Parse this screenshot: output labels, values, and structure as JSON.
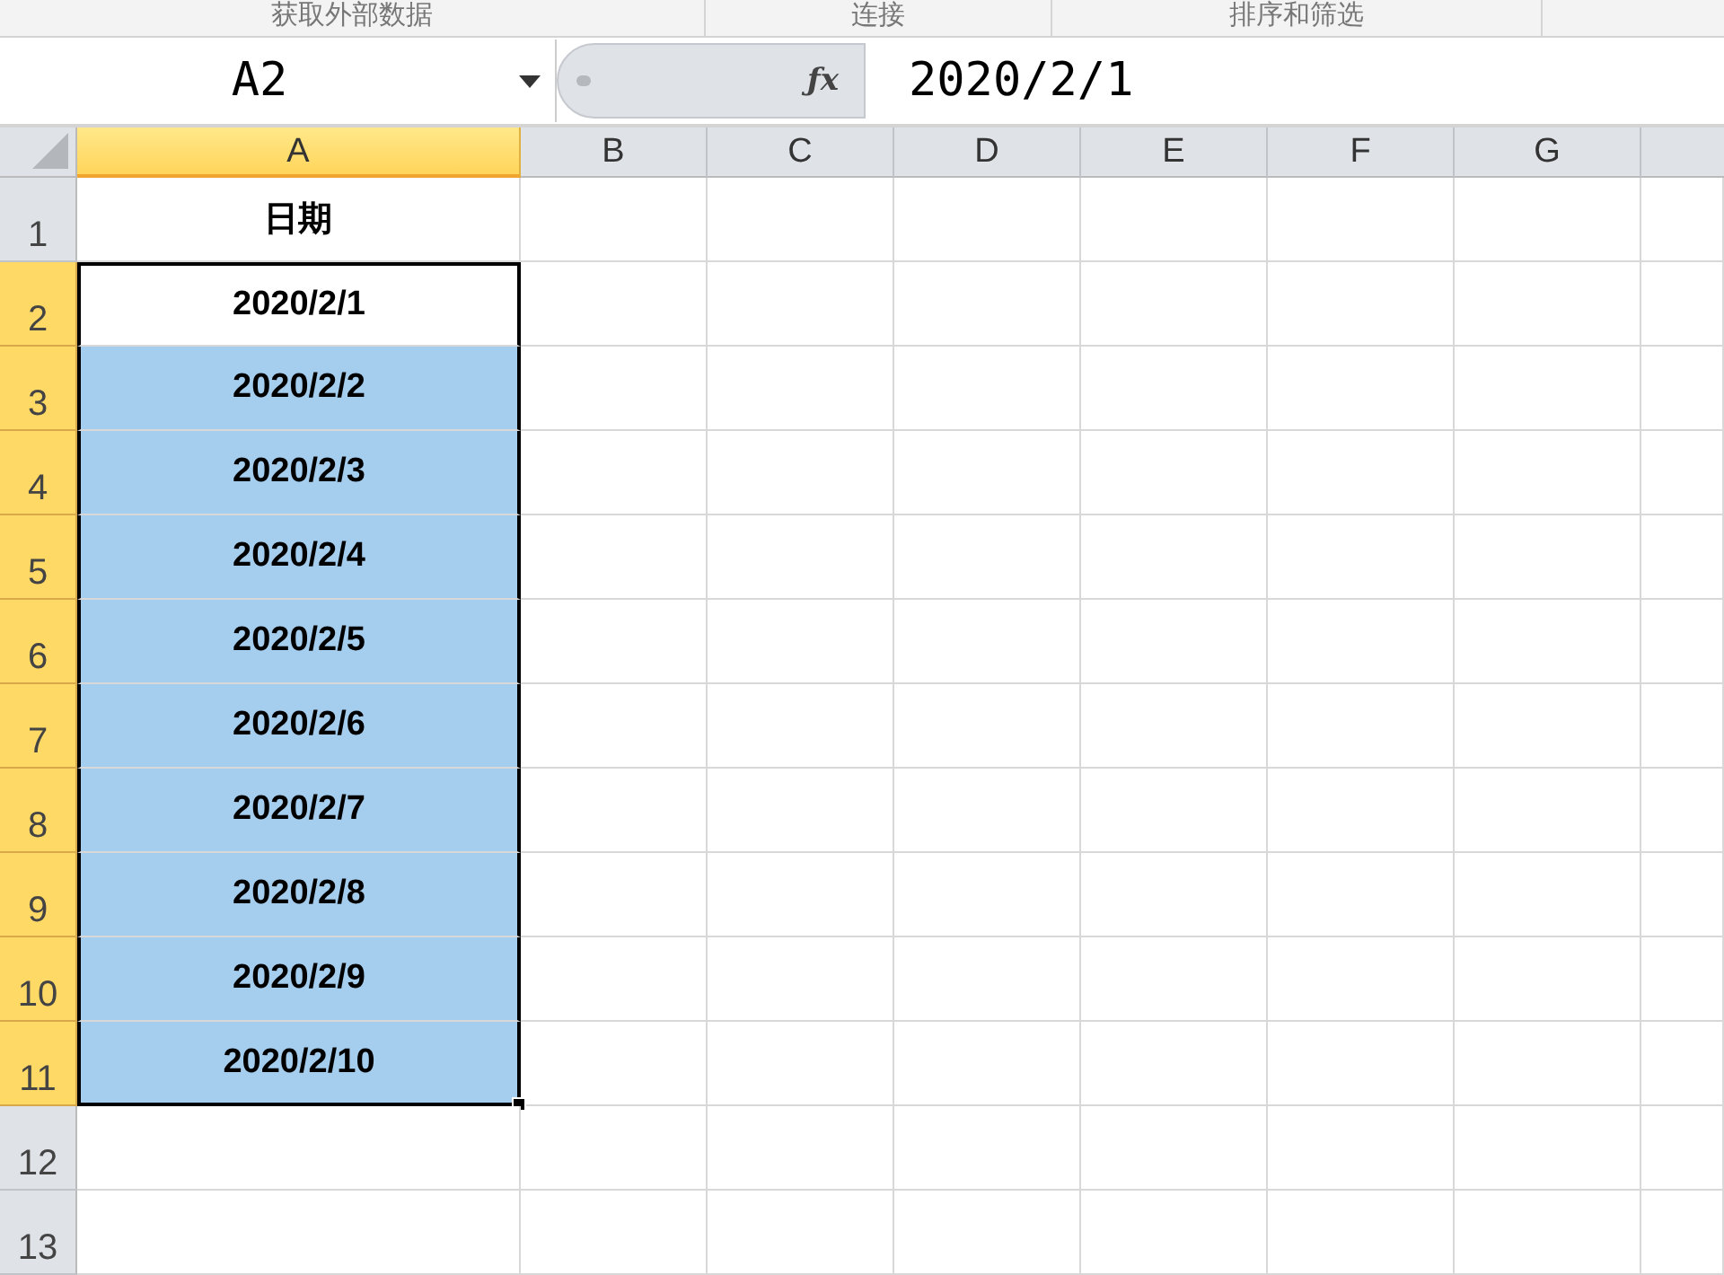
{
  "ribbon_groups": [
    "获取外部数据",
    "连接",
    "排序和筛选"
  ],
  "formula_bar": {
    "name_box": "A2",
    "function_button": "ƒx",
    "value": "2020/2/1"
  },
  "columns": [
    {
      "label": "A",
      "selected": true
    },
    {
      "label": "B",
      "selected": false
    },
    {
      "label": "C",
      "selected": false
    },
    {
      "label": "D",
      "selected": false
    },
    {
      "label": "E",
      "selected": false
    },
    {
      "label": "F",
      "selected": false
    },
    {
      "label": "G",
      "selected": false
    }
  ],
  "rows": [
    {
      "number": "1",
      "selected": false,
      "cell": {
        "text": "日期",
        "selected": false,
        "active": false
      }
    },
    {
      "number": "2",
      "selected": true,
      "cell": {
        "text": "2020/2/1",
        "selected": true,
        "active": true
      }
    },
    {
      "number": "3",
      "selected": true,
      "cell": {
        "text": "2020/2/2",
        "selected": true,
        "active": false
      }
    },
    {
      "number": "4",
      "selected": true,
      "cell": {
        "text": "2020/2/3",
        "selected": true,
        "active": false
      }
    },
    {
      "number": "5",
      "selected": true,
      "cell": {
        "text": "2020/2/4",
        "selected": true,
        "active": false
      }
    },
    {
      "number": "6",
      "selected": true,
      "cell": {
        "text": "2020/2/5",
        "selected": true,
        "active": false
      }
    },
    {
      "number": "7",
      "selected": true,
      "cell": {
        "text": "2020/2/6",
        "selected": true,
        "active": false
      }
    },
    {
      "number": "8",
      "selected": true,
      "cell": {
        "text": "2020/2/7",
        "selected": true,
        "active": false
      }
    },
    {
      "number": "9",
      "selected": true,
      "cell": {
        "text": "2020/2/8",
        "selected": true,
        "active": false
      }
    },
    {
      "number": "10",
      "selected": true,
      "cell": {
        "text": "2020/2/9",
        "selected": true,
        "active": false
      }
    },
    {
      "number": "11",
      "selected": true,
      "cell": {
        "text": "2020/2/10",
        "selected": true,
        "active": false
      }
    },
    {
      "number": "12",
      "selected": false,
      "cell": {
        "selected": false,
        "active": false
      }
    },
    {
      "number": "13",
      "selected": false,
      "cell": {
        "selected": false,
        "active": false
      }
    }
  ]
}
